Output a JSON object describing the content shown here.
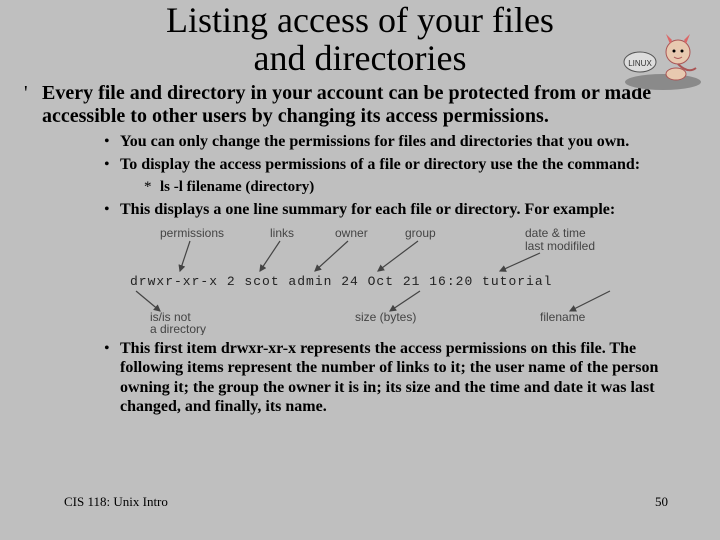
{
  "title_line1": "Listing access of your files",
  "title_line2": "and directories",
  "mascot_name": "linux-daemon-mascot",
  "main_bullet": "Every file and directory in your account can be protected from or made accessible to other users by changing its access permissions.",
  "sub": {
    "a": "You can only change the permissions for files and directories that you own.",
    "b": "To display the access permissions of a file or directory use the the command:",
    "cmd": "ls -l filename (directory)",
    "c": "This displays a one line summary for each file or directory. For example:",
    "d": "This first item drwxr-xr-x represents the access permissions on this file. The following items represent the number of links to it; the user name of the person owning it; the group the owner it is in; its size and the time and date it was last changed, and finally, its name."
  },
  "diagram": {
    "labels": {
      "permissions": "permissions",
      "links": "links",
      "owner": "owner",
      "group": "group",
      "datetime1": "date & time",
      "datetime2": "last modifiled",
      "isnot1": "is/is not",
      "isnot2": "a directory",
      "size": "size (bytes)",
      "filename": "filename"
    },
    "line": "drwxr-xr-x   2  scot  admin  24  Oct 21  16:20   tutorial"
  },
  "footer": {
    "course": "CIS 118: Unix Intro",
    "page": "50"
  }
}
